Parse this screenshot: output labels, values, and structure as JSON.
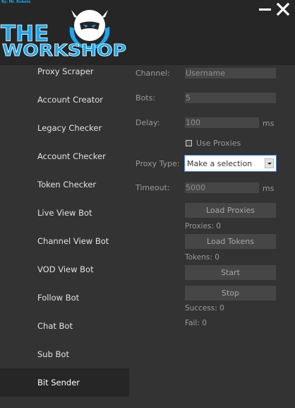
{
  "app": {
    "credit": "By: Mr. Roboto",
    "logo_line1": "THE",
    "logo_line2": "WORKSHOP"
  },
  "window_controls": [
    "minimize-icon",
    "close-icon"
  ],
  "sidebar": {
    "items": [
      {
        "label": "Proxy Scraper",
        "active": false
      },
      {
        "label": "Account Creator",
        "active": false
      },
      {
        "label": "Legacy Checker",
        "active": false
      },
      {
        "label": "Account Checker",
        "active": false
      },
      {
        "label": "Token Checker",
        "active": false
      },
      {
        "label": "Live View Bot",
        "active": false
      },
      {
        "label": "Channel View Bot",
        "active": false
      },
      {
        "label": "VOD View Bot",
        "active": false
      },
      {
        "label": "Follow Bot",
        "active": false
      },
      {
        "label": "Chat Bot",
        "active": false
      },
      {
        "label": "Sub Bot",
        "active": false
      },
      {
        "label": "Bit Sender",
        "active": true
      }
    ]
  },
  "form": {
    "channel": {
      "label": "Channel:",
      "value": "Username"
    },
    "bots": {
      "label": "Bots:",
      "value": "5"
    },
    "delay": {
      "label": "Delay:",
      "value": "100",
      "unit": "ms"
    },
    "use_proxies": {
      "label": "Use Proxies",
      "checked": false
    },
    "proxy_type": {
      "label": "Proxy Type:",
      "value": "Make a selection"
    },
    "timeout": {
      "label": "Timeout:",
      "value": "5000",
      "unit": "ms"
    },
    "load_proxies": "Load Proxies",
    "proxies_count": "Proxies: 0",
    "load_tokens": "Load Tokens",
    "tokens_count": "Tokens: 0",
    "start": "Start",
    "stop": "Stop",
    "success": "Success: 0",
    "fail": "Fail: 0"
  },
  "colors": {
    "accent": "#1aa7f0",
    "background": "#262626",
    "panel": "#333333",
    "field": "#464646"
  }
}
